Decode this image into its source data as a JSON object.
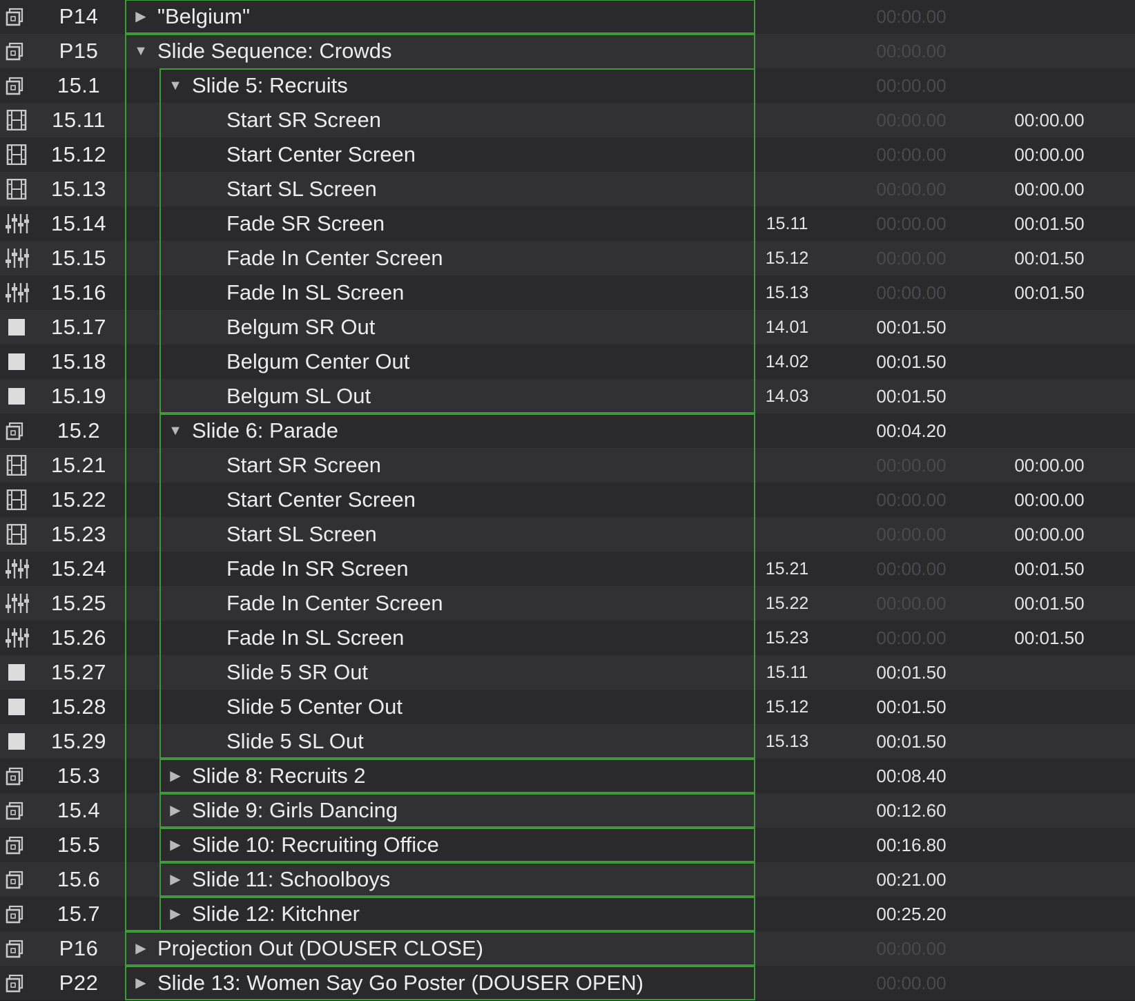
{
  "colors": {
    "group_outline": "#3f9a3c",
    "row_even": "#2a2a2d",
    "row_odd": "#313134",
    "text": "#ececec",
    "dim_text": "#4a4a4e"
  },
  "cues": [
    {
      "icon": "group-icon",
      "number": "P14",
      "name": "\"Belgium\"",
      "depth": 0,
      "disclosure": "collapsed",
      "target": "",
      "prewait": "00:00.00",
      "prewait_dim": true,
      "action": ""
    },
    {
      "icon": "group-icon",
      "number": "P15",
      "name": "Slide Sequence: Crowds",
      "depth": 0,
      "disclosure": "expanded",
      "target": "",
      "prewait": "00:00.00",
      "prewait_dim": true,
      "action": ""
    },
    {
      "icon": "group-icon",
      "number": "15.1",
      "name": "Slide 5: Recruits",
      "depth": 1,
      "disclosure": "expanded",
      "target": "",
      "prewait": "00:00.00",
      "prewait_dim": true,
      "action": ""
    },
    {
      "icon": "video-icon",
      "number": "15.11",
      "name": "Start SR Screen",
      "depth": 2,
      "disclosure": "none",
      "target": "",
      "prewait": "00:00.00",
      "prewait_dim": true,
      "action": "00:00.00"
    },
    {
      "icon": "video-icon",
      "number": "15.12",
      "name": "Start Center Screen",
      "depth": 2,
      "disclosure": "none",
      "target": "",
      "prewait": "00:00.00",
      "prewait_dim": true,
      "action": "00:00.00"
    },
    {
      "icon": "video-icon",
      "number": "15.13",
      "name": "Start SL Screen",
      "depth": 2,
      "disclosure": "none",
      "target": "",
      "prewait": "00:00.00",
      "prewait_dim": true,
      "action": "00:00.00"
    },
    {
      "icon": "fade-icon",
      "number": "15.14",
      "name": "Fade SR Screen",
      "depth": 2,
      "disclosure": "none",
      "target": "15.11",
      "prewait": "00:00.00",
      "prewait_dim": true,
      "action": "00:01.50"
    },
    {
      "icon": "fade-icon",
      "number": "15.15",
      "name": "Fade In Center Screen",
      "depth": 2,
      "disclosure": "none",
      "target": "15.12",
      "prewait": "00:00.00",
      "prewait_dim": true,
      "action": "00:01.50"
    },
    {
      "icon": "fade-icon",
      "number": "15.16",
      "name": "Fade In SL Screen",
      "depth": 2,
      "disclosure": "none",
      "target": "15.13",
      "prewait": "00:00.00",
      "prewait_dim": true,
      "action": "00:01.50"
    },
    {
      "icon": "stop-icon",
      "number": "15.17",
      "name": "Belgum SR Out",
      "depth": 2,
      "disclosure": "none",
      "target": "14.01",
      "prewait": "00:01.50",
      "prewait_dim": false,
      "action": ""
    },
    {
      "icon": "stop-icon",
      "number": "15.18",
      "name": "Belgum Center Out",
      "depth": 2,
      "disclosure": "none",
      "target": "14.02",
      "prewait": "00:01.50",
      "prewait_dim": false,
      "action": ""
    },
    {
      "icon": "stop-icon",
      "number": "15.19",
      "name": "Belgum SL Out",
      "depth": 2,
      "disclosure": "none",
      "target": "14.03",
      "prewait": "00:01.50",
      "prewait_dim": false,
      "action": ""
    },
    {
      "icon": "group-icon",
      "number": "15.2",
      "name": "Slide 6: Parade",
      "depth": 1,
      "disclosure": "expanded",
      "target": "",
      "prewait": "00:04.20",
      "prewait_dim": false,
      "action": ""
    },
    {
      "icon": "video-icon",
      "number": "15.21",
      "name": "Start SR Screen",
      "depth": 2,
      "disclosure": "none",
      "target": "",
      "prewait": "00:00.00",
      "prewait_dim": true,
      "action": "00:00.00"
    },
    {
      "icon": "video-icon",
      "number": "15.22",
      "name": "Start Center Screen",
      "depth": 2,
      "disclosure": "none",
      "target": "",
      "prewait": "00:00.00",
      "prewait_dim": true,
      "action": "00:00.00"
    },
    {
      "icon": "video-icon",
      "number": "15.23",
      "name": "Start SL Screen",
      "depth": 2,
      "disclosure": "none",
      "target": "",
      "prewait": "00:00.00",
      "prewait_dim": true,
      "action": "00:00.00"
    },
    {
      "icon": "fade-icon",
      "number": "15.24",
      "name": "Fade In SR Screen",
      "depth": 2,
      "disclosure": "none",
      "target": "15.21",
      "prewait": "00:00.00",
      "prewait_dim": true,
      "action": "00:01.50"
    },
    {
      "icon": "fade-icon",
      "number": "15.25",
      "name": "Fade In Center Screen",
      "depth": 2,
      "disclosure": "none",
      "target": "15.22",
      "prewait": "00:00.00",
      "prewait_dim": true,
      "action": "00:01.50"
    },
    {
      "icon": "fade-icon",
      "number": "15.26",
      "name": "Fade In SL Screen",
      "depth": 2,
      "disclosure": "none",
      "target": "15.23",
      "prewait": "00:00.00",
      "prewait_dim": true,
      "action": "00:01.50"
    },
    {
      "icon": "stop-icon",
      "number": "15.27",
      "name": "Slide 5 SR Out",
      "depth": 2,
      "disclosure": "none",
      "target": "15.11",
      "prewait": "00:01.50",
      "prewait_dim": false,
      "action": ""
    },
    {
      "icon": "stop-icon",
      "number": "15.28",
      "name": "Slide 5 Center Out",
      "depth": 2,
      "disclosure": "none",
      "target": "15.12",
      "prewait": "00:01.50",
      "prewait_dim": false,
      "action": ""
    },
    {
      "icon": "stop-icon",
      "number": "15.29",
      "name": "Slide 5 SL Out",
      "depth": 2,
      "disclosure": "none",
      "target": "15.13",
      "prewait": "00:01.50",
      "prewait_dim": false,
      "action": ""
    },
    {
      "icon": "group-icon",
      "number": "15.3",
      "name": "Slide 8: Recruits 2",
      "depth": 1,
      "disclosure": "collapsed",
      "target": "",
      "prewait": "00:08.40",
      "prewait_dim": false,
      "action": ""
    },
    {
      "icon": "group-icon",
      "number": "15.4",
      "name": "Slide 9: Girls Dancing",
      "depth": 1,
      "disclosure": "collapsed",
      "target": "",
      "prewait": "00:12.60",
      "prewait_dim": false,
      "action": ""
    },
    {
      "icon": "group-icon",
      "number": "15.5",
      "name": "Slide 10: Recruiting Office",
      "depth": 1,
      "disclosure": "collapsed",
      "target": "",
      "prewait": "00:16.80",
      "prewait_dim": false,
      "action": ""
    },
    {
      "icon": "group-icon",
      "number": "15.6",
      "name": "Slide 11: Schoolboys",
      "depth": 1,
      "disclosure": "collapsed",
      "target": "",
      "prewait": "00:21.00",
      "prewait_dim": false,
      "action": ""
    },
    {
      "icon": "group-icon",
      "number": "15.7",
      "name": "Slide 12: Kitchner",
      "depth": 1,
      "disclosure": "collapsed",
      "target": "",
      "prewait": "00:25.20",
      "prewait_dim": false,
      "action": ""
    },
    {
      "icon": "group-icon",
      "number": "P16",
      "name": "Projection Out (DOUSER CLOSE)",
      "depth": 0,
      "disclosure": "collapsed",
      "target": "",
      "prewait": "00:00.00",
      "prewait_dim": true,
      "action": ""
    },
    {
      "icon": "group-icon",
      "number": "P22",
      "name": "Slide 13: Women Say Go Poster (DOUSER OPEN)",
      "depth": 0,
      "disclosure": "collapsed",
      "target": "",
      "prewait": "00:00.00",
      "prewait_dim": true,
      "action": ""
    }
  ]
}
